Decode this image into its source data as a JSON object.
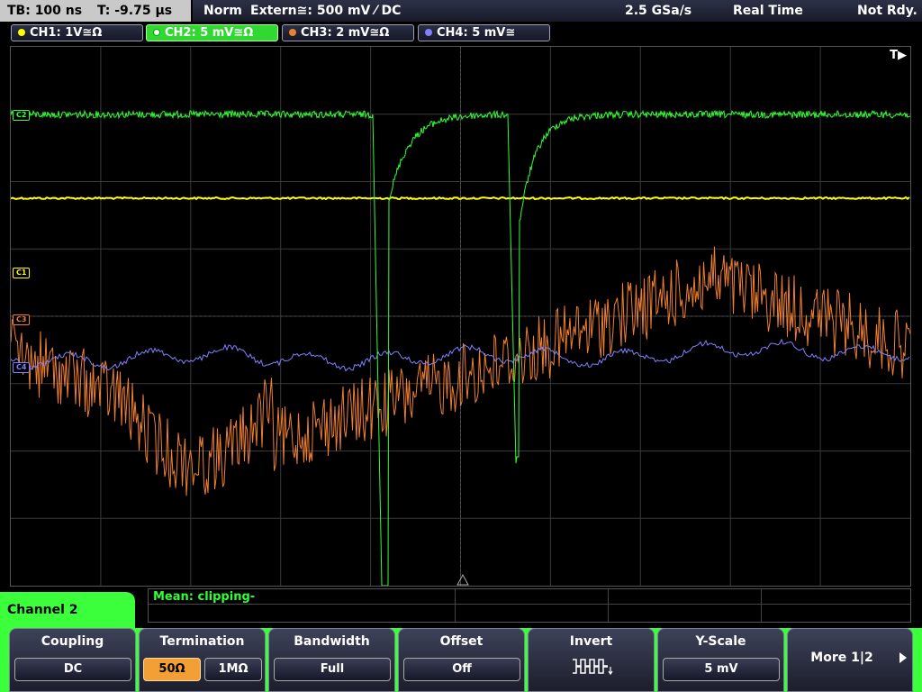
{
  "status": {
    "timebase": "TB: 100 ns",
    "trigger_time": "T: -9.75 µs",
    "mode": "Norm",
    "trigger_source": "Extern≅: 500 mV ⁄ DC",
    "sample_rate": "2.5 GSa/s",
    "acquisition": "Real Time",
    "state": "Not Rdy."
  },
  "channels": [
    {
      "label": "CH1: 1V≅Ω",
      "color": "#ffff00"
    },
    {
      "label": "CH2: 5 mV≅Ω",
      "color": "#32ff32"
    },
    {
      "label": "CH3: 2 mV≅Ω",
      "color": "#f08030"
    },
    {
      "label": "CH4: 5 mV≅",
      "color": "#8080ff"
    }
  ],
  "grid": {
    "trigger_marker": "T▶",
    "ref_labels": {
      "c2": "C2",
      "c1": "C1",
      "c3": "C3",
      "c4": "C4"
    }
  },
  "measurement": {
    "text": "Mean: clipping-"
  },
  "menu": {
    "title": "Channel 2",
    "coupling": {
      "label": "Coupling",
      "value": "DC"
    },
    "termination": {
      "label": "Termination",
      "opt1": "50Ω",
      "opt2": "1MΩ"
    },
    "bandwidth": {
      "label": "Bandwidth",
      "value": "Full"
    },
    "offset": {
      "label": "Offset",
      "value": "Off"
    },
    "invert": {
      "label": "Invert"
    },
    "yscale": {
      "label": "Y-Scale",
      "value": "5 mV"
    },
    "more": {
      "label": "More 1|2"
    }
  }
}
